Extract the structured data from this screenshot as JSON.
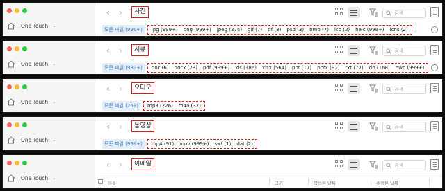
{
  "device_name": "One Touch",
  "nav": {
    "back": "‹",
    "forward": "›"
  },
  "search": {
    "placeholder": "검색"
  },
  "all_files_label_prefix": "모든 파일",
  "panels": [
    {
      "title": "사진",
      "all_files": "모든 파일 (999+)",
      "extensions": [
        "jpg (999+)",
        "png (999+)",
        "jpeg (374)",
        "gif (7)",
        "tif (8)",
        "psd (3)",
        "bmp (7)",
        "ico (2)",
        "heic (999+)",
        "icns (2)"
      ]
    },
    {
      "title": "서류",
      "all_files": "모든 파일 (999+)",
      "extensions": [
        "doc (6)",
        "docx (23)",
        "pdf (999+)",
        "xls (186)",
        "xlsx (564)",
        "ppt (17)",
        "pptx (92)",
        "txt (77)",
        "db (168)",
        "hwp (999+)"
      ]
    },
    {
      "title": "오디오",
      "all_files": "모든 파일 (263)",
      "extensions": [
        "mp3 (226)",
        "m4a (37)"
      ]
    },
    {
      "title": "동영상",
      "all_files": "모든 파일 (999+)",
      "extensions": [
        "mp4 (91)",
        "mov (999+)",
        "swf (1)",
        "dat (2)"
      ]
    },
    {
      "title": "이메일",
      "columns": {
        "name": "이름",
        "size": "크기",
        "created": "작성된 날짜",
        "modified": "수정된 날짜"
      }
    }
  ],
  "colors": {
    "highlight": "#e21b1b",
    "chip_bg": "#e4eef8",
    "chip_text": "#3f7fc0"
  }
}
